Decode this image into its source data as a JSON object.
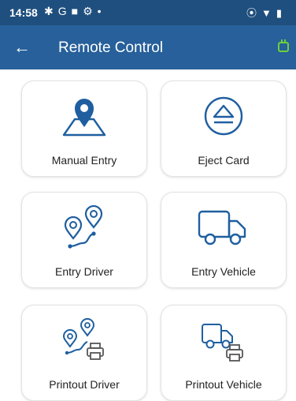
{
  "status_bar": {
    "time": "14:58",
    "left_icons": [
      "gear-icon",
      "google-icon",
      "folder-icon",
      "settings-icon",
      "dot-icon"
    ],
    "right_icons": [
      "location-icon",
      "wifi-icon",
      "battery-icon"
    ]
  },
  "app_bar": {
    "title": "Remote Control",
    "background": "#27609a",
    "status_bar_background": "#1f4f7e",
    "plug_status_color": "#6ccf3c"
  },
  "cards": [
    {
      "label": "Manual Entry",
      "icon": "map-pin-area-icon"
    },
    {
      "label": "Eject Card",
      "icon": "eject-icon"
    },
    {
      "label": "Entry Driver",
      "icon": "route-pins-icon"
    },
    {
      "label": "Entry Vehicle",
      "icon": "truck-icon"
    },
    {
      "label": "Printout Driver",
      "icon": "route-print-icon"
    },
    {
      "label": "Printout Vehicle",
      "icon": "truck-print-icon"
    }
  ],
  "accent_color": "#1f5fa0"
}
